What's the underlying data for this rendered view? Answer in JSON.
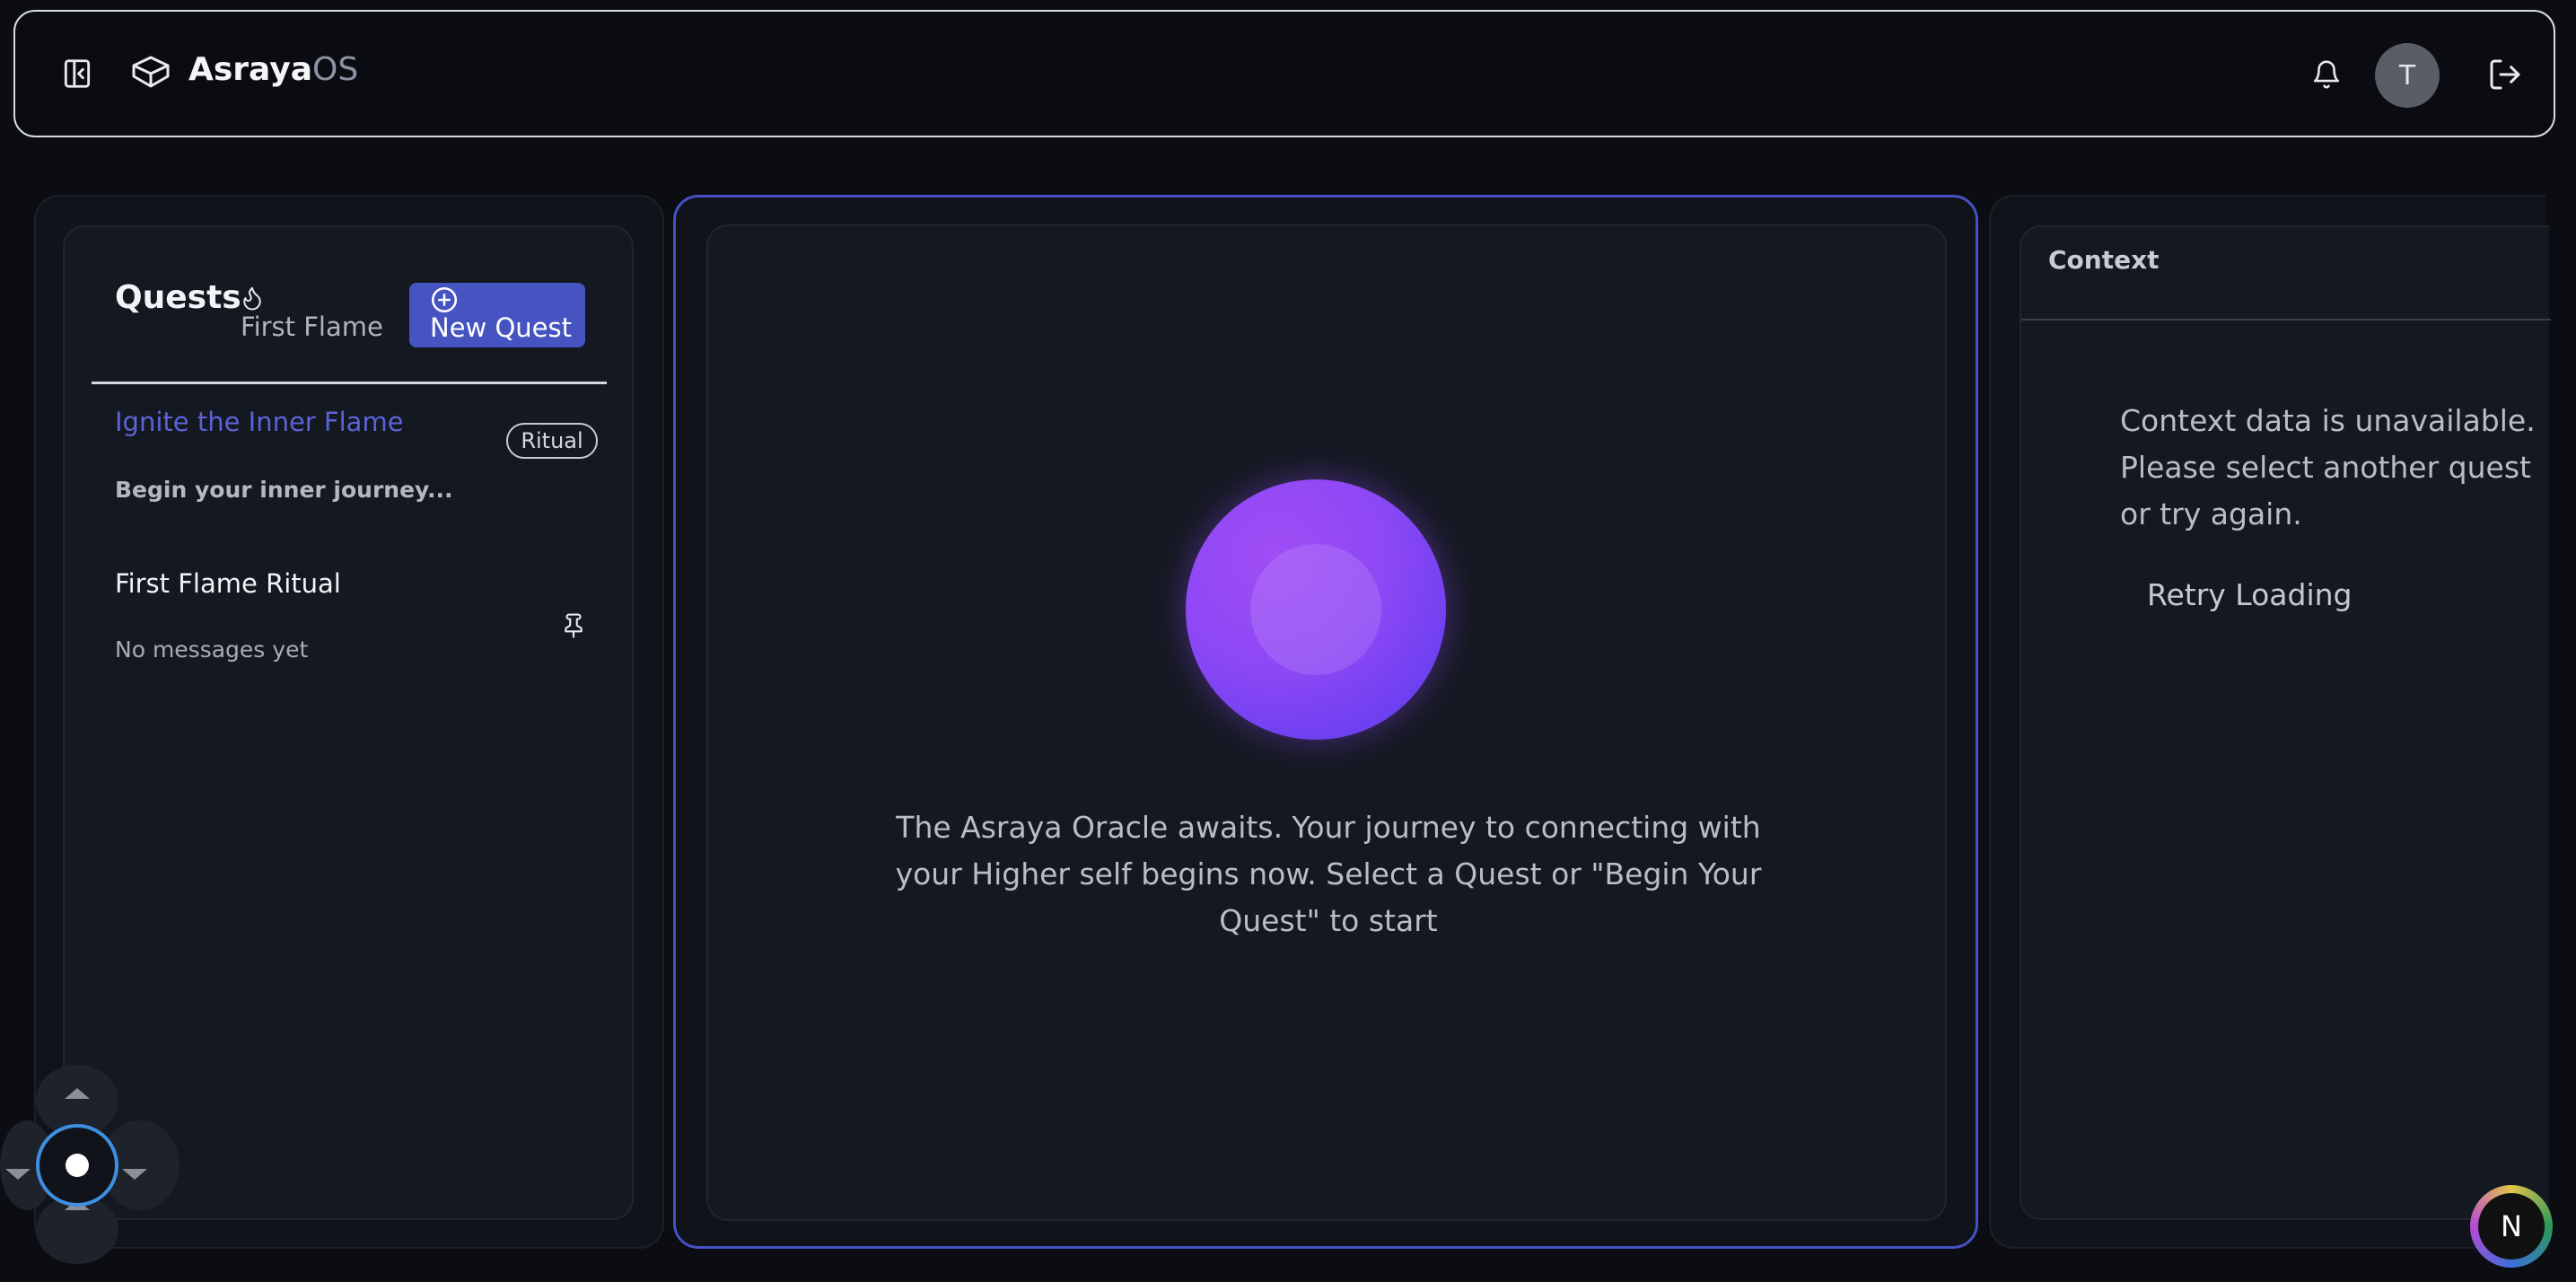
{
  "header": {
    "brand_primary": "Asraya",
    "brand_secondary": "OS",
    "avatar_initial": "T"
  },
  "quests": {
    "title": "Quests",
    "streak_label": "First Flame",
    "new_quest_label": "New Quest",
    "items": [
      {
        "title": "Ignite the Inner Flame",
        "badge": "Ritual",
        "description": "Begin your inner journey...",
        "active": true
      },
      {
        "title": "First Flame Ritual",
        "subtitle": "No messages yet",
        "pinned": true
      }
    ]
  },
  "oracle": {
    "message": "The Asraya Oracle awaits. Your journey to connecting with your Higher self begins now. Select a Quest or \"Begin Your Quest\" to start"
  },
  "context": {
    "title": "Context",
    "message": "Context data is unavailable. Please select another quest or try again.",
    "retry_label": "Retry Loading"
  },
  "badge": {
    "letter": "N"
  },
  "colors": {
    "accent": "#4654c2",
    "active_text": "#5b63d6",
    "orb": "#8d48f5",
    "background": "#0b0d12"
  }
}
